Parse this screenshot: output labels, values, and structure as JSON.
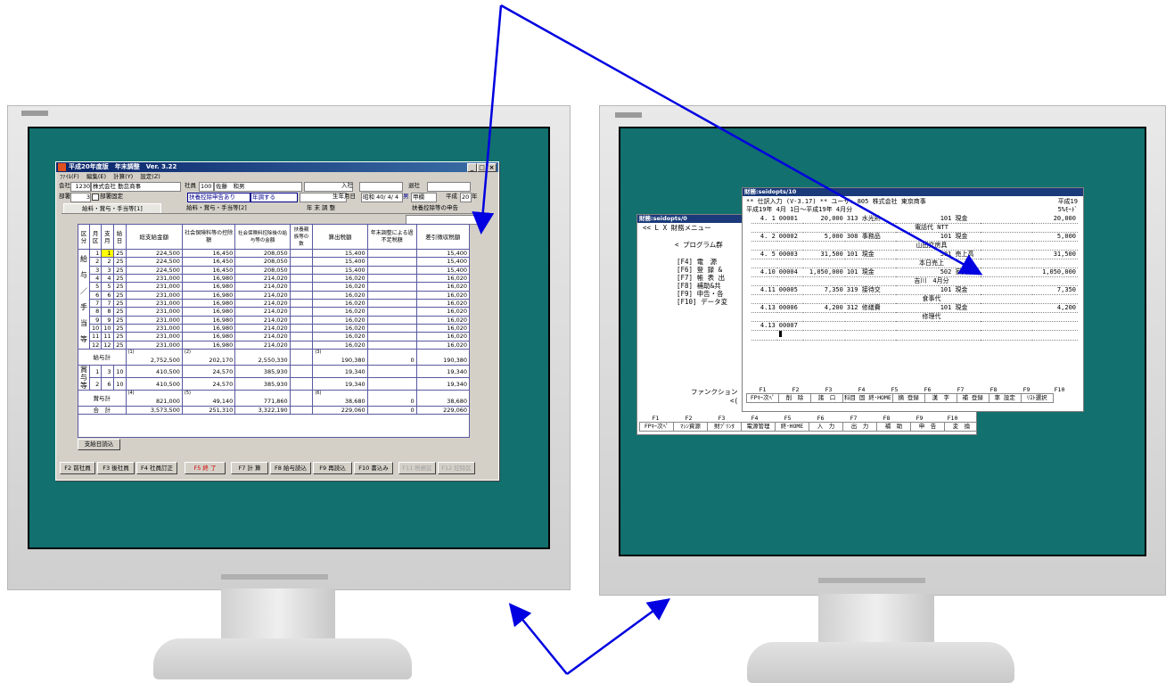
{
  "left_window": {
    "title": "平成20年度版　年末調整　Ver. 3.22",
    "menu": [
      "ﾌｧｲﾙ(F)",
      "編集(E)",
      "計算(Y)",
      "設定(Z)"
    ],
    "controls": [
      "_",
      "□",
      "×"
    ],
    "company_label": "会社",
    "company_code": "1230",
    "company_name": "株式会社 勤怠商事",
    "employee_label": "社員",
    "employee_code": "100",
    "employee_name": "佐藤　和男",
    "hire_label": "入社",
    "retire_label": "退社",
    "dept_label": "部署",
    "dept_code": "3",
    "dept_fixed_label": "部署固定",
    "dependent_status": "扶養控除申告あり",
    "year_end_status": "年調する",
    "birth_label": "生年月日",
    "birth_value": "昭和 40/ 4/ 4",
    "sex": "男",
    "tax_class": "甲欄",
    "year_label": "平成",
    "year_value": "20",
    "year_suffix": "年",
    "tabs": [
      "給料・賞与・手当等[1]",
      "給料・賞与・手当等[2]",
      "年 末 調 整",
      "扶養控除等の申告"
    ],
    "headers": {
      "kubun": "区分",
      "month": "月区",
      "shikyu": "支月",
      "kyuyo": "給日",
      "total": "総支給金額",
      "social": "社会保険料等の控除額",
      "after": "社会保険料控除後の給与等の金額",
      "dep": "扶養親族等の数",
      "tax": "算出税額",
      "short": "年末調整による過不足税額",
      "withhold": "差引徴収税額"
    },
    "salary_label": [
      "給",
      "与",
      "／",
      "手",
      "当",
      "等"
    ],
    "salary_rows": [
      [
        "1",
        "1",
        "25",
        "224,500",
        "16,450",
        "208,050",
        "15,400",
        "15,400"
      ],
      [
        "2",
        "2",
        "25",
        "224,500",
        "16,450",
        "208,050",
        "15,400",
        "15,400"
      ],
      [
        "3",
        "3",
        "25",
        "224,500",
        "16,450",
        "208,050",
        "15,400",
        "15,400"
      ],
      [
        "4",
        "4",
        "25",
        "231,000",
        "16,980",
        "214,020",
        "16,020",
        "16,020"
      ],
      [
        "5",
        "5",
        "25",
        "231,000",
        "16,980",
        "214,020",
        "16,020",
        "16,020"
      ],
      [
        "6",
        "6",
        "25",
        "231,000",
        "16,980",
        "214,020",
        "16,020",
        "16,020"
      ],
      [
        "7",
        "7",
        "25",
        "231,000",
        "16,980",
        "214,020",
        "16,020",
        "16,020"
      ],
      [
        "8",
        "8",
        "25",
        "231,000",
        "16,980",
        "214,020",
        "16,020",
        "16,020"
      ],
      [
        "9",
        "9",
        "25",
        "231,000",
        "16,980",
        "214,020",
        "16,020",
        "16,020"
      ],
      [
        "10",
        "10",
        "25",
        "231,000",
        "16,980",
        "214,020",
        "16,020",
        "16,020"
      ],
      [
        "11",
        "11",
        "25",
        "231,000",
        "16,980",
        "214,020",
        "16,020",
        "16,020"
      ],
      [
        "12",
        "12",
        "25",
        "231,000",
        "16,980",
        "214,020",
        "16,020",
        "16,020"
      ]
    ],
    "salary_total": {
      "label": "給与計",
      "n1": "(1)",
      "v1": "2,752,500",
      "n2": "(2)",
      "v2": "202,170",
      "v3": "2,550,330",
      "n3": "(3)",
      "v4": "190,380",
      "v5": "0",
      "v6": "190,380"
    },
    "bonus_label": [
      "賞",
      "与",
      "等"
    ],
    "bonus_rows": [
      [
        "1",
        "3",
        "10",
        "410,500",
        "24,570",
        "385,930",
        "19,340",
        "19,340"
      ],
      [
        "2",
        "6",
        "10",
        "410,500",
        "24,570",
        "385,930",
        "19,340",
        "19,340"
      ]
    ],
    "bonus_total": {
      "label": "賞与計",
      "n4": "(4)",
      "v1": "821,000",
      "n5": "(5)",
      "v2": "49,140",
      "v3": "771,860",
      "n6": "(6)",
      "v4": "38,680",
      "v5": "0",
      "v6": "38,680"
    },
    "grand_total": {
      "label": "合　計",
      "v1": "3,573,500",
      "v2": "251,310",
      "v3": "3,322,190",
      "v4": "229,060",
      "v5": "0",
      "v6": "229,060"
    },
    "pay_day_button": "支給日読込",
    "fkeys": [
      "F2 前社員",
      "F3 後社員",
      "F4 社員訂正",
      "F5 終 了",
      "F7 計 算",
      "F8 給与読込",
      "F9 再読込",
      "F10 書込み",
      "F11 税務区",
      "F12 控除区"
    ]
  },
  "right_back_window": {
    "title": "財務:seidopts/0",
    "line1": "<<  L X  財務メニュー",
    "line2": "< プログラム群",
    "items": [
      "[F4] 電　源",
      "[F6] 登 録 &",
      "[F7] 帳 表 出",
      "[F8] 補助&共",
      "[F9] 申告・各",
      "[F10] データ変"
    ],
    "function_line": "ファンクション",
    "function_line2": "<(",
    "fkey_nums": [
      "F1",
      "F2",
      "F3",
      "F4",
      "F5",
      "F6",
      "F7",
      "F8",
      "F9",
      "F10"
    ],
    "fkey_labels": [
      "FPｷｰ次ﾍﾟ",
      "ﾏｼﾝ資源",
      "財ﾌﾟﾘﾝﾀ",
      "電源管理",
      "終･HOME",
      "入　力",
      "出　力",
      "補　助",
      "申　告",
      "変　換"
    ]
  },
  "right_front_window": {
    "title": "財務:seidopts/10",
    "header1": "** 仕訳入力 (V-3.17) ** ユーザ:  805 株式会社 東京商事",
    "header1_right": "平成19",
    "header2": "平成19年 4月 1日〜平成19年 4月分",
    "header2_right": "5%ﾓｰﾄﾞ",
    "entries": [
      {
        "date": "4. 1",
        "no": "00001",
        "amt_l": "20,000",
        "acct_l": "313 水光熱",
        "acct_r": "101 現金",
        "amt_r": "20,000",
        "memo": "電話代 NTT"
      },
      {
        "date": "4. 2",
        "no": "00002",
        "amt_l": "5,000",
        "acct_l": "308 事務品",
        "acct_r": "101 現金",
        "amt_r": "5,000",
        "memo": "山田文房具"
      },
      {
        "date": "4. 5",
        "no": "00003",
        "amt_l": "31,500",
        "acct_l": "101 現金",
        "acct_r": "501 売上高",
        "amt_r": "31,500",
        "memo": "本日売上"
      },
      {
        "date": "4.10",
        "no": "00004",
        "amt_l": "1,050,000",
        "acct_l": "101 現金",
        "acct_r": "502 家賃収",
        "amt_r": "1,050,000",
        "memo": "吉川　4月分"
      },
      {
        "date": "4.11",
        "no": "00005",
        "amt_l": "7,350",
        "acct_l": "319 接待交",
        "acct_r": "101 現金",
        "amt_r": "7,350",
        "memo": "食事代"
      },
      {
        "date": "4.13",
        "no": "00006",
        "amt_l": "4,200",
        "acct_l": "312 修繕費",
        "acct_r": "101 現金",
        "amt_r": "4,200",
        "memo": "修理代"
      }
    ],
    "last_date": "4.13",
    "last_no": "00007",
    "fkey_nums": [
      "F1",
      "F2",
      "F3",
      "F4",
      "F5",
      "F6",
      "F7",
      "F8",
      "F9",
      "F10"
    ],
    "fkey_labels": [
      "FPｷｰ次ﾍﾟ",
      "削　除",
      "諸　口",
      "科目 固 終･HOME",
      "摘 登録",
      "漢　字",
      "補 登録",
      "率 設定",
      "ﾘｽﾄ選択"
    ]
  },
  "colors": {
    "screen": "#12706e",
    "arrow": "#0000e0",
    "title_bar": "#0a246a"
  }
}
